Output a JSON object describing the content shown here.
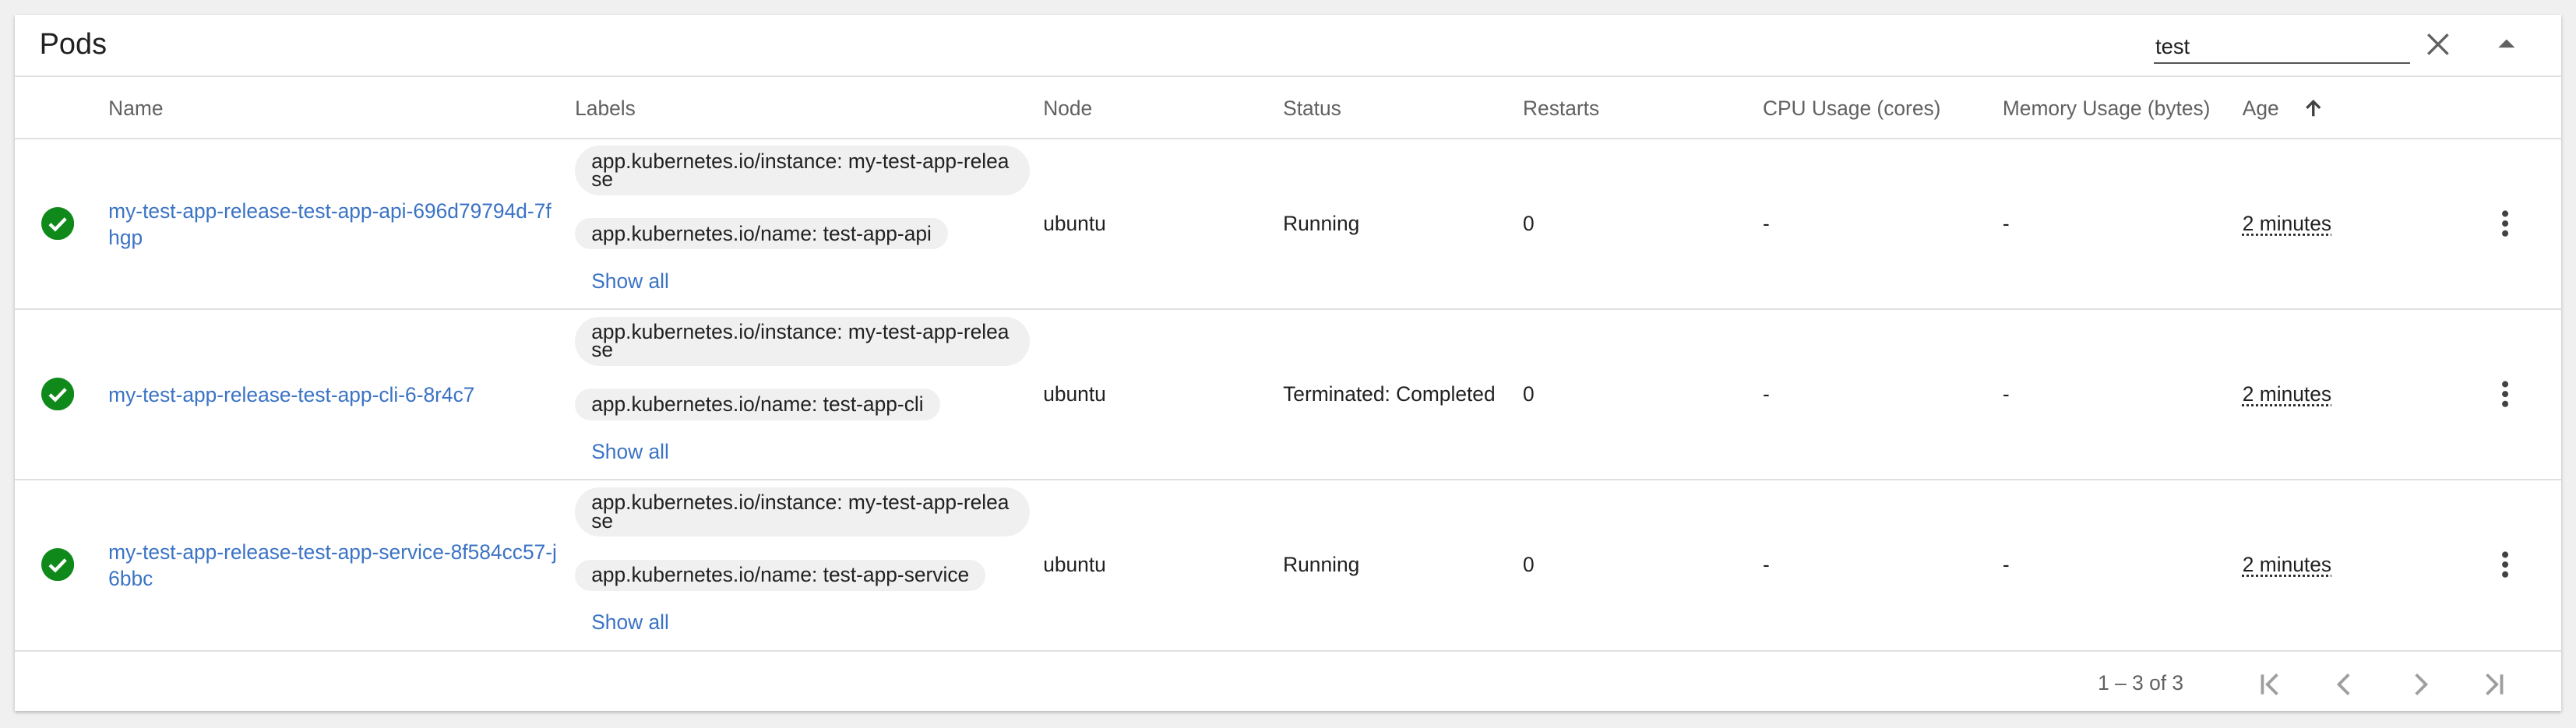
{
  "header": {
    "title": "Pods"
  },
  "search": {
    "value": "test"
  },
  "columns": {
    "name": "Name",
    "labels": "Labels",
    "node": "Node",
    "status": "Status",
    "restarts": "Restarts",
    "cpu": "CPU Usage (cores)",
    "memory": "Memory Usage (bytes)",
    "age": "Age"
  },
  "rows": [
    {
      "name": "my-test-app-release-test-app-api-696d79794d-7fhgp",
      "label1": "app.kubernetes.io/instance: my-test-app-release",
      "label2": "app.kubernetes.io/name: test-app-api",
      "show_all": "Show all",
      "node": "ubuntu",
      "status": "Running",
      "restarts": "0",
      "cpu": "-",
      "memory": "-",
      "age": "2 minutes"
    },
    {
      "name": "my-test-app-release-test-app-cli-6-8r4c7",
      "label1": "app.kubernetes.io/instance: my-test-app-release",
      "label2": "app.kubernetes.io/name: test-app-cli",
      "show_all": "Show all",
      "node": "ubuntu",
      "status": "Terminated: Completed",
      "restarts": "0",
      "cpu": "-",
      "memory": "-",
      "age": "2 minutes"
    },
    {
      "name": "my-test-app-release-test-app-service-8f584cc57-j6bbc",
      "label1": "app.kubernetes.io/instance: my-test-app-release",
      "label2": "app.kubernetes.io/name: test-app-service",
      "show_all": "Show all",
      "node": "ubuntu",
      "status": "Running",
      "restarts": "0",
      "cpu": "-",
      "memory": "-",
      "age": "2 minutes"
    }
  ],
  "pagination": {
    "range": "1 – 3 of 3"
  },
  "icons": {
    "status_ok": "check-circle-icon",
    "clear": "close-icon",
    "collapse": "arrow-drop-up-icon",
    "sort": "arrow-upward-icon",
    "menu": "more-vert-icon",
    "first": "first-page-icon",
    "prev": "chevron-left-icon",
    "next": "chevron-right-icon",
    "last": "last-page-icon"
  },
  "colors": {
    "link": "#3b73c5",
    "success": "#0f8a1a",
    "chip_bg": "#f0f0f0"
  }
}
